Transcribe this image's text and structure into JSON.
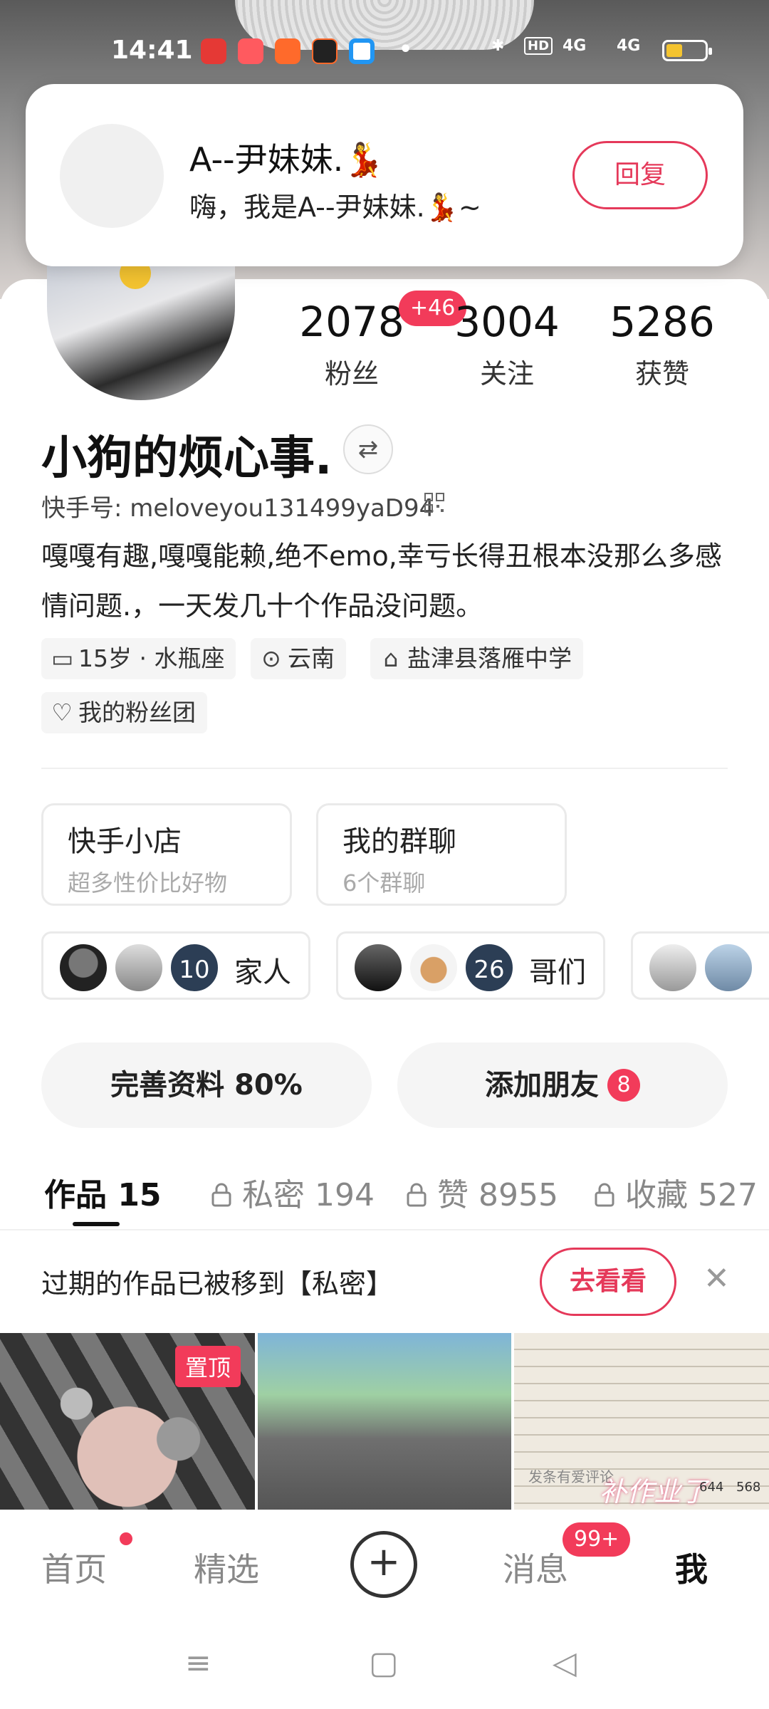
{
  "status_bar": {
    "time": "14:41",
    "hd_label": "HD",
    "net1": "4G",
    "net2": "4G"
  },
  "notification": {
    "sender": "A--尹妹妹.💃",
    "message": "嗨，我是A--尹妹妹.💃~",
    "reply_label": "回复"
  },
  "profile": {
    "stats": [
      {
        "value": "2078",
        "label": "粉丝"
      },
      {
        "value": "3004",
        "label": "关注"
      },
      {
        "value": "5286",
        "label": "获赞"
      }
    ],
    "new_fans_badge": "+46",
    "nickname": "小狗的烦心事.",
    "kuaishou_id": "快手号: meloveyou131499yaD94",
    "bio": "嘎嘎有趣,嘎嘎能赖,绝不emo,幸亏长得丑根本没那么多感情问题.，一天发几十个作品没问题。",
    "tags": {
      "age": "15岁 · 水瓶座",
      "location": "云南",
      "school": "盐津县落雁中学",
      "fan_club": "我的粉丝团"
    }
  },
  "features": {
    "shop": {
      "title": "快手小店",
      "subtitle": "超多性价比好物"
    },
    "group_chat": {
      "title": "我的群聊",
      "subtitle": "6个群聊"
    }
  },
  "groups": [
    {
      "count": "10",
      "name": "家人"
    },
    {
      "count": "26",
      "name": "哥们"
    }
  ],
  "actions": {
    "complete_profile": "完善资料 80%",
    "add_friends": "添加朋友",
    "add_friends_count": "8"
  },
  "tabs": [
    {
      "label": "作品 15"
    },
    {
      "label": "私密 194"
    },
    {
      "label": "赞 8955"
    },
    {
      "label": "收藏 527"
    }
  ],
  "notice": {
    "text": "过期的作品已被移到【私密】",
    "button": "去看看"
  },
  "thumbnails": {
    "pinned_label": "置顶",
    "comment_hint": "发条有爱评论",
    "handwriting": "补作业了",
    "count1": "644",
    "count2": "568"
  },
  "bottom_nav": {
    "items": [
      "首页",
      "精选",
      "消息",
      "我"
    ],
    "message_badge": "99+"
  },
  "colors": {
    "accent": "#f23b5a",
    "outline_accent": "#e5395a"
  }
}
